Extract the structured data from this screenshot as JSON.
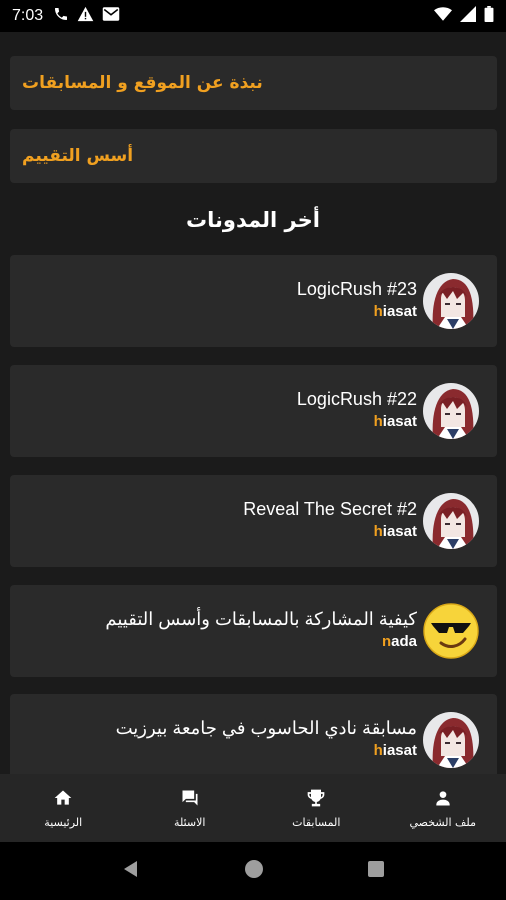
{
  "status_bar": {
    "time": "7:03",
    "icons_left": [
      "phone-icon",
      "warning-icon",
      "mail-icon"
    ],
    "icons_right": [
      "wifi-icon",
      "signal-icon",
      "battery-icon"
    ]
  },
  "links": [
    {
      "label": "نبذة عن الموقع و المسابقات"
    },
    {
      "label": "أسس التقييم"
    }
  ],
  "section_title": "أخر المدونات",
  "posts": [
    {
      "title": "LogicRush #23",
      "author_first": "h",
      "author_rest": "iasat",
      "avatar": "anime-avatar"
    },
    {
      "title": "LogicRush #22",
      "author_first": "h",
      "author_rest": "iasat",
      "avatar": "anime-avatar"
    },
    {
      "title": "Reveal The Secret #2",
      "author_first": "h",
      "author_rest": "iasat",
      "avatar": "anime-avatar"
    },
    {
      "title": "كيفية المشاركة بالمسابقات وأسس التقييم",
      "author_first": "n",
      "author_rest": "ada",
      "avatar": "sunglasses-emoji-avatar"
    },
    {
      "title": "مسابقة نادي الحاسوب في جامعة بيرزيت",
      "author_first": "h",
      "author_rest": "iasat",
      "avatar": "anime-avatar"
    }
  ],
  "bottom_nav": [
    {
      "label": "الرئيسية",
      "icon": "home-icon"
    },
    {
      "label": "الاسئلة",
      "icon": "chat-icon"
    },
    {
      "label": "المسابقات",
      "icon": "trophy-icon"
    },
    {
      "label": "ملف الشخصي",
      "icon": "person-icon"
    }
  ],
  "colors": {
    "accent": "#f0a020",
    "background": "#1b1b1b",
    "card": "#2a2a2a"
  }
}
